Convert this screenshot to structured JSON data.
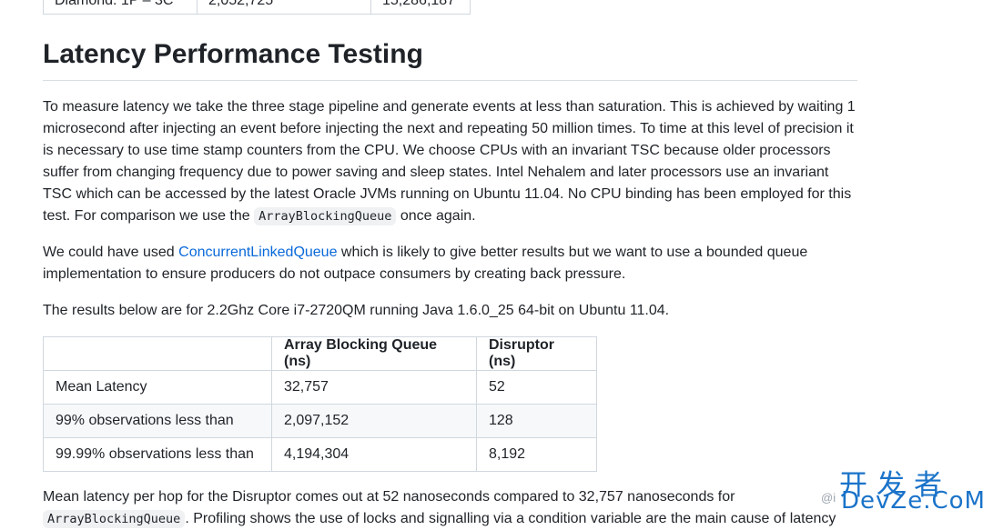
{
  "top_table": {
    "cells": [
      "Diamond: 1P – 3C",
      "2,052,725",
      "15,286,187"
    ]
  },
  "heading": "Latency Performance Testing",
  "para1": {
    "text_before_code": "To measure latency we take the three stage pipeline and generate events at less than saturation. This is achieved by waiting 1 microsecond after injecting an event before injecting the next and repeating 50 million times. To time at this level of precision it is necessary to use time stamp counters from the CPU. We choose CPUs with an invariant TSC because older processors suffer from changing frequency due to power saving and sleep states. Intel Nehalem and later processors use an invariant TSC which can be accessed by the latest Oracle JVMs running on Ubuntu 11.04. No CPU binding has been employed for this test. For comparison we use the ",
    "code": "ArrayBlockingQueue",
    "text_after_code": " once again."
  },
  "para2": {
    "text_before_link": "We could have used ",
    "link": "ConcurrentLinkedQueue",
    "text_after_link": " which is likely to give better results but we want to use a bounded queue implementation to ensure producers do not outpace consumers by creating back pressure."
  },
  "para3": "The results below are for 2.2Ghz Core i7-2720QM running Java 1.6.0_25 64-bit on Ubuntu 11.04.",
  "results_table": {
    "headers": [
      "",
      "Array Blocking Queue (ns)",
      "Disruptor (ns)"
    ],
    "rows": [
      [
        "Mean Latency",
        "32,757",
        "52"
      ],
      [
        "99% observations less than",
        "2,097,152",
        "128"
      ],
      [
        "99.99% observations less than",
        "4,194,304",
        "8,192"
      ]
    ]
  },
  "para4": {
    "text_line1": "Mean latency per hop for the Disruptor comes out at 52 nanoseconds compared to 32,757 nanoseconds for",
    "code": "ArrayBlockingQueue",
    "text_after_code": ". Profiling shows the use of locks and signalling via a condition variable are the main cause of latency"
  },
  "watermark": {
    "cn": "开发者",
    "en": "DevZe.CoM",
    "at": "@i"
  },
  "colors": {
    "link": "#0969da",
    "watermark": "#1a73c9"
  }
}
